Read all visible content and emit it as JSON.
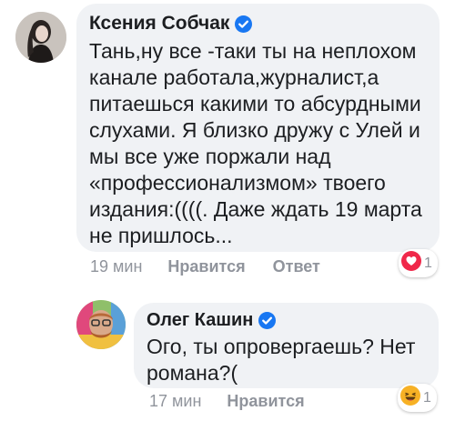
{
  "comments": [
    {
      "author": "Ксения Собчак",
      "verified": true,
      "text_lines": [
        "Тань,ну все -таки ты на неплохом",
        "канале работала,журналист,а",
        "питаешься какими то абсурдными",
        "слухами. Я близко дружу с Улей и",
        "мы все уже поржали над",
        "«профессионализмом» твоего",
        "издания:((((. Даже ждать 19 марта",
        "не пришлось..."
      ],
      "time": "19 мин",
      "like_label": "Нравится",
      "reply_label": "Ответ",
      "reaction": {
        "icon": "love-reaction-icon",
        "color": "#f0284a",
        "count": "1"
      }
    },
    {
      "author": "Олег Кашин",
      "verified": true,
      "text_lines": [
        "Ого, ты опровергаешь? Нет",
        "романа?("
      ],
      "time": "17 мин",
      "like_label": "Нравится",
      "reaction": {
        "icon": "haha-reaction-icon",
        "color": "#f7b125",
        "count": "1"
      }
    }
  ],
  "colors": {
    "bubble": "#f0f2f5",
    "verified": "#1877f2",
    "meta": "#90949c"
  }
}
